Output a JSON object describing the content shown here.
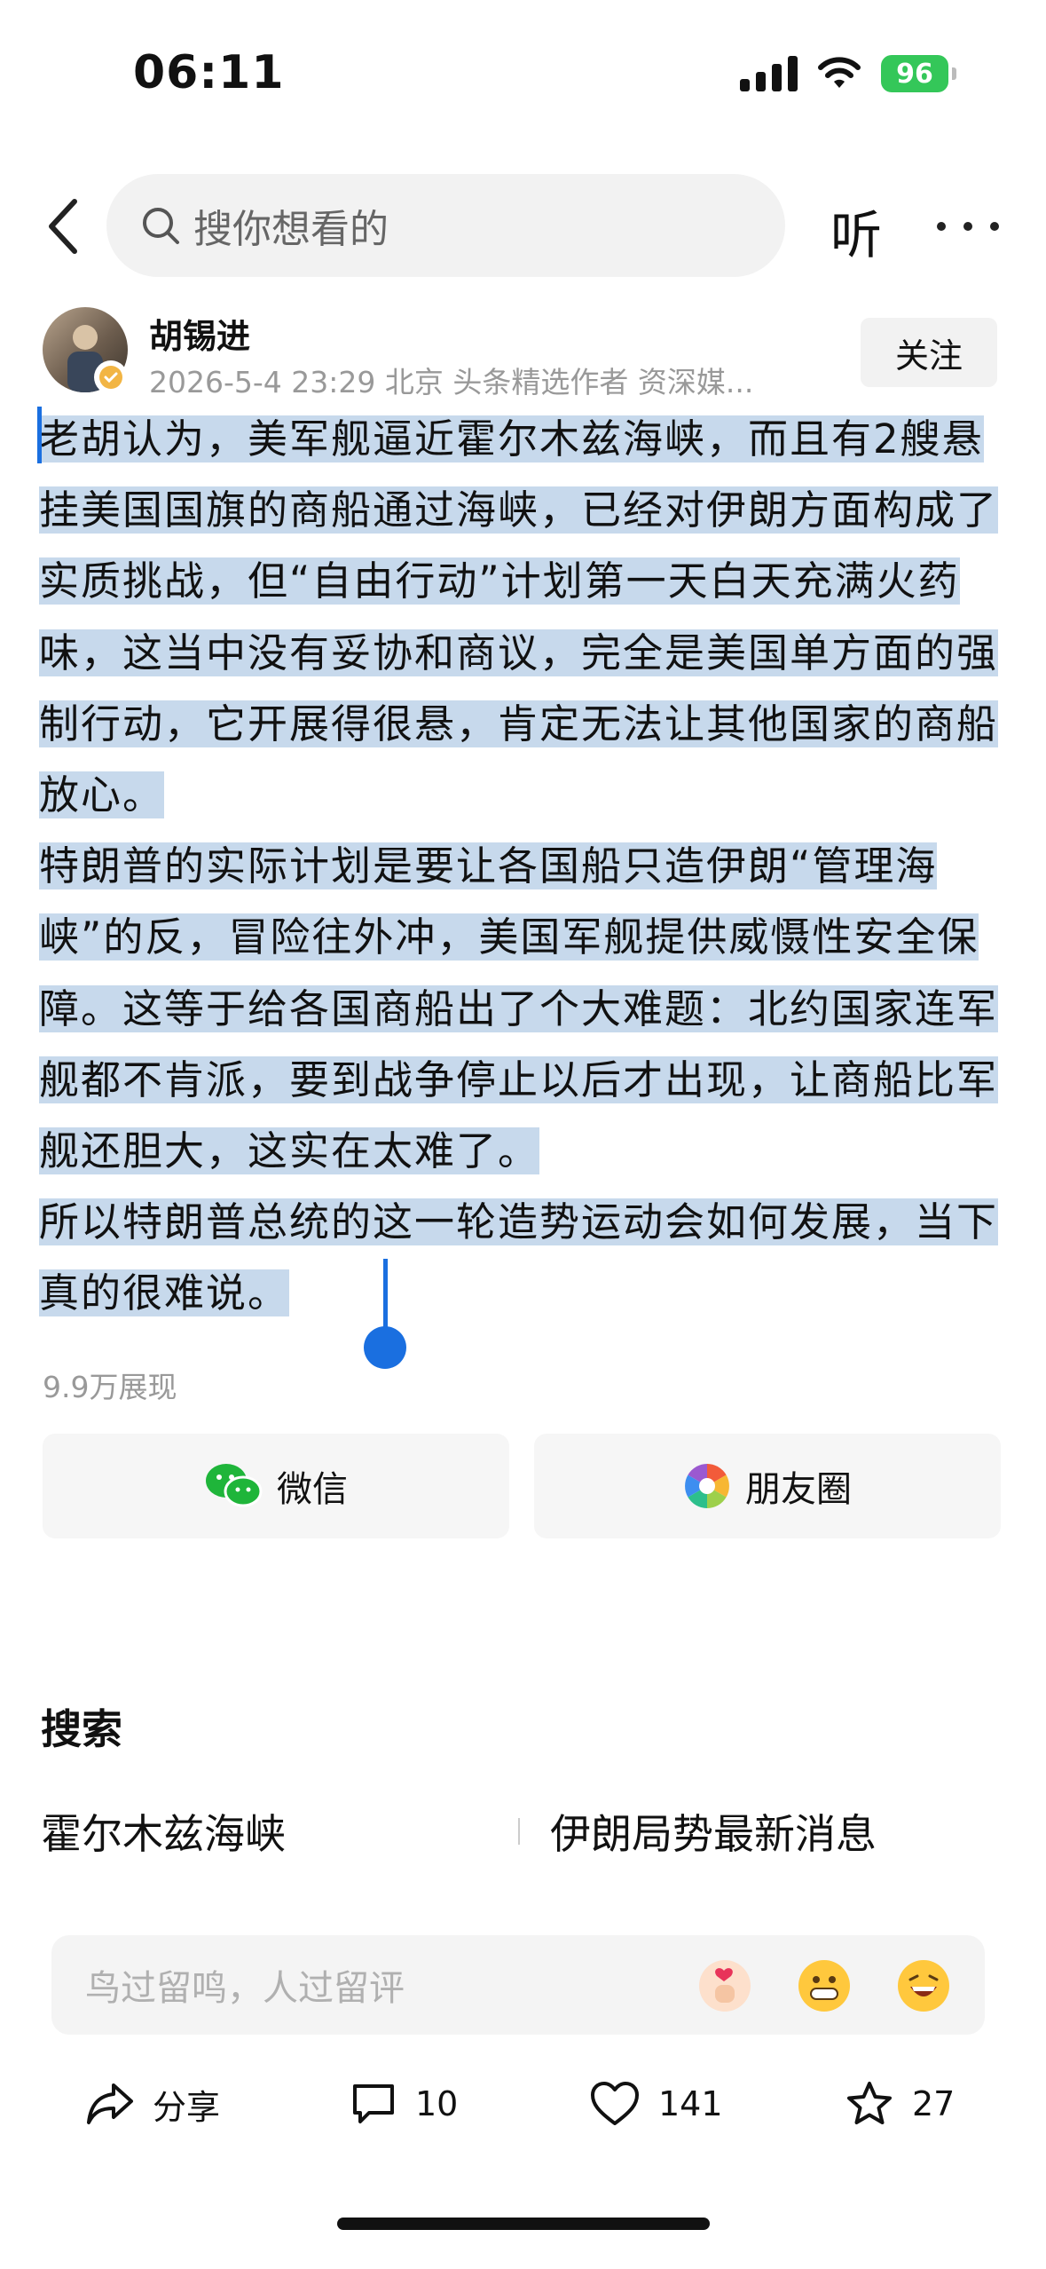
{
  "status_bar": {
    "time": "06:11",
    "battery": "96"
  },
  "nav": {
    "search_placeholder": "搜你想看的",
    "listen_label": "听"
  },
  "author": {
    "name": "胡锡进",
    "meta": "2026-5-4 23:29  北京  头条精选作者 资深媒...",
    "follow_label": "关注"
  },
  "article": {
    "paragraphs": [
      "老胡认为，美军舰逼近霍尔木兹海峡，而且有2艘悬挂美国国旗的商船通过海峡，已经对伊朗方面构成了实质挑战，但“自由行动”计划第一天白天充满火药味，这当中没有妥协和商议，完全是美国单方面的强制行动，它开展得很悬，肯定无法让其他国家的商船放心。",
      "特朗普的实际计划是要让各国船只造伊朗“管理海峡”的反，冒险往外冲，美国军舰提供威慑性安全保障。这等于给各国商船出了个大难题：北约国家连军舰都不肯派，要到战争停止以后才出现，让商船比军舰还胆大，这实在太难了。",
      "所以特朗普总统的这一轮造势运动会如何发展，当下真的很难说。"
    ],
    "views": "9.9万展现"
  },
  "share": {
    "wechat_label": "微信",
    "moments_label": "朋友圈"
  },
  "search_section": {
    "title": "搜索",
    "suggestions": [
      "霍尔木兹海峡",
      "伊朗局势最新消息"
    ]
  },
  "comment": {
    "placeholder": "鸟过留鸣，人过留评"
  },
  "actions": {
    "share_label": "分享",
    "comments": "10",
    "likes": "141",
    "favorites": "27"
  }
}
